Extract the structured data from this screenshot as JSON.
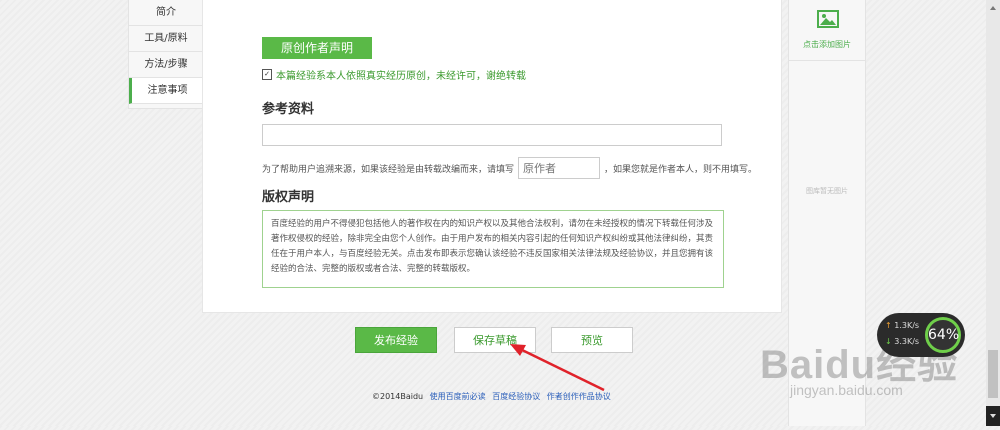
{
  "left_nav": {
    "items": [
      "简介",
      "工具/原料",
      "方法/步骤",
      "注意事项"
    ],
    "active": "注意事项"
  },
  "original": {
    "button_label": "原创作者声明",
    "statement": "本篇经验系本人依照真实经历原创，未经许可，谢绝转载"
  },
  "reference": {
    "title": "参考资料",
    "source_prefix": "为了帮助用户追溯来源，如果该经验是由转载改编而来，请填写",
    "author_placeholder": "原作者",
    "source_suffix": "，如果您就是作者本人，则不用填写。"
  },
  "copyright": {
    "title": "版权声明",
    "text": "百度经验的用户不得侵犯包括他人的著作权在内的知识产权以及其他合法权利，请勿在未经授权的情况下转载任何涉及著作权侵权的经验，除非完全由您个人创作。由于用户发布的相关内容引起的任何知识产权纠纷或其他法律纠纷，其责任在于用户本人，与百度经验无关。点击发布即表示您确认该经验不违反国家相关法律法规及经验协议，并且您拥有该经验的合法、完整的版权或者合法、完整的转载版权。"
  },
  "right_sidebar": {
    "add_picture": "点击添加图片",
    "no_picture": "图库暂无图片"
  },
  "buttons": {
    "publish": "发布经验",
    "save_draft": "保存草稿",
    "preview": "预览"
  },
  "footer": {
    "copyright": "©2014Baidu",
    "links": [
      "使用百度前必读",
      "百度经验协议",
      "作者创作作品协议"
    ]
  },
  "speed_widget": {
    "upload": "1.3K/s",
    "download": "3.3K/s",
    "percent": "64%"
  },
  "watermark": {
    "brand": "Baidu经验",
    "url": "jingyan.baidu.com"
  },
  "colors": {
    "accent_green": "#5ab947",
    "link_blue": "#2b5fba",
    "arrow_red": "#e0222a"
  }
}
